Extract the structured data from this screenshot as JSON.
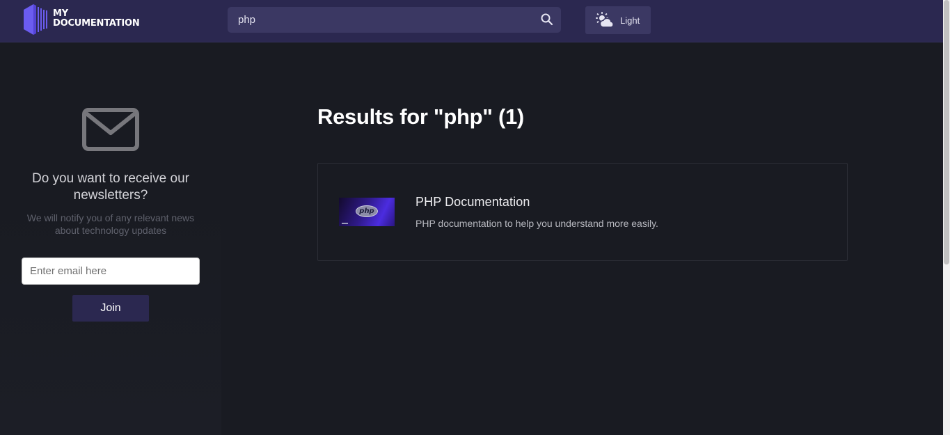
{
  "header": {
    "logo_line1": "MY",
    "logo_line2": "DOCUMENTATION",
    "search": {
      "value": "php",
      "icon": "search-icon"
    },
    "theme_toggle": {
      "label": "Light",
      "icon": "sun-cloud-icon"
    }
  },
  "sidebar": {
    "icon": "mail-icon",
    "newsletter_title": "Do you want to receive our newsletters?",
    "newsletter_subtitle": "We will notify you of any relevant news about technology updates",
    "email_placeholder": "Enter email here",
    "join_label": "Join"
  },
  "main": {
    "results_heading": "Results for \"php\" (1)",
    "results": [
      {
        "title": "PHP Documentation",
        "description": "PHP documentation to help you understand more easily.",
        "thumbnail_text": "php"
      }
    ]
  },
  "colors": {
    "header_bg": "#2b2850",
    "page_bg": "#191b22",
    "accent": "#5b53e6",
    "join_button": "#2b2850"
  }
}
